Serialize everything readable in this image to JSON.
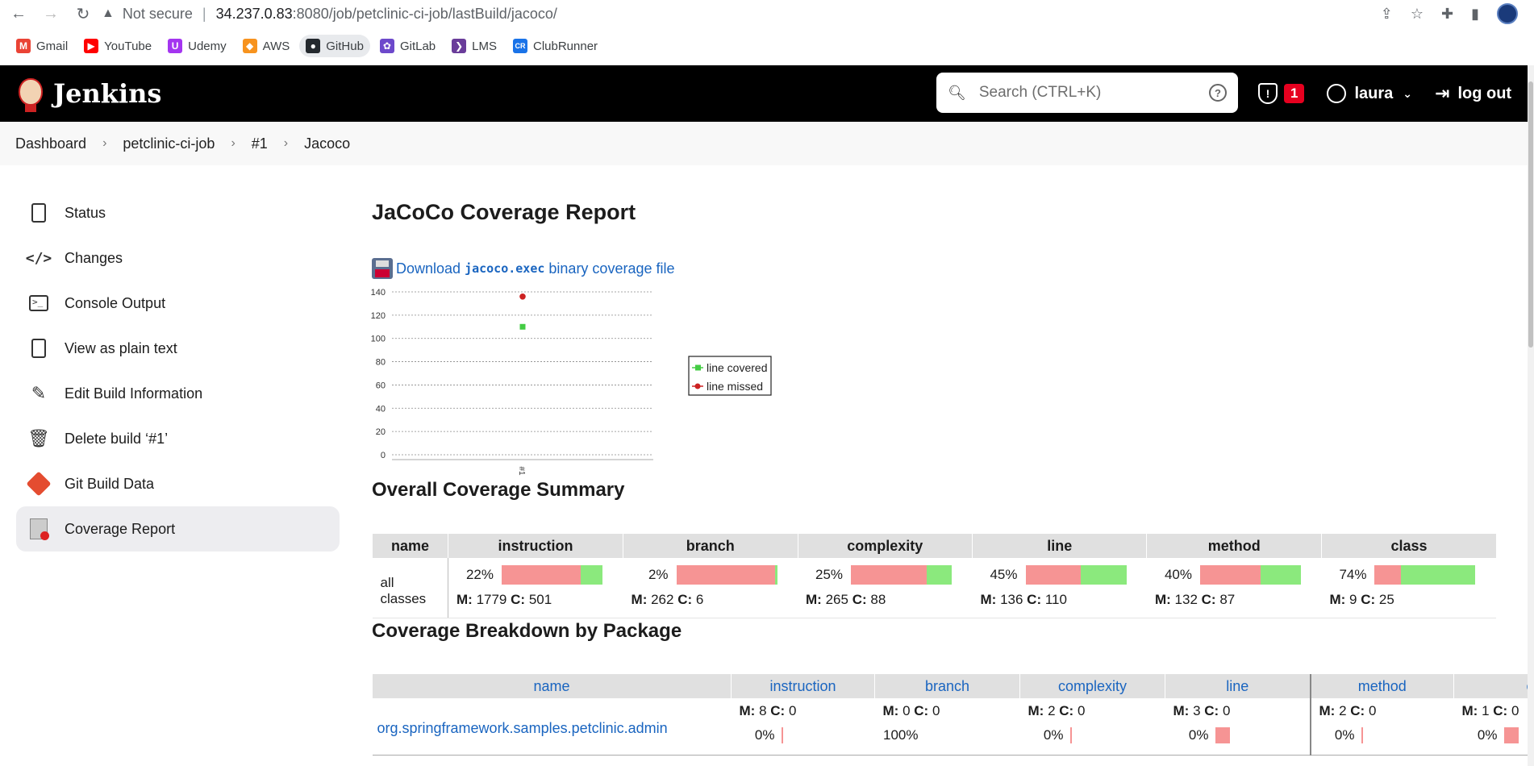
{
  "browser": {
    "security_label": "Not secure",
    "url_host": "34.237.0.83",
    "url_path": ":8080/job/petclinic-ci-job/lastBuild/jacoco/",
    "bookmarks": [
      {
        "label": "Gmail",
        "color": "#ea4335",
        "glyph": "M"
      },
      {
        "label": "YouTube",
        "color": "#ff0000",
        "glyph": "▶"
      },
      {
        "label": "Udemy",
        "color": "#a435f0",
        "glyph": "U"
      },
      {
        "label": "AWS",
        "color": "#f7931e",
        "glyph": "◆"
      },
      {
        "label": "GitHub",
        "color": "#24292e",
        "glyph": "●"
      },
      {
        "label": "GitLab",
        "color": "#6d49cb",
        "glyph": "✿"
      },
      {
        "label": "LMS",
        "color": "#6a3d9a",
        "glyph": "❯"
      },
      {
        "label": "ClubRunner",
        "color": "#1a73e8",
        "glyph": "CR"
      }
    ]
  },
  "header": {
    "app_name": "Jenkins",
    "search_placeholder": "Search (CTRL+K)",
    "security_count": "1",
    "username": "laura",
    "logout_label": "log out"
  },
  "breadcrumb": [
    "Dashboard",
    "petclinic-ci-job",
    "#1",
    "Jacoco"
  ],
  "sidebar": {
    "items": [
      {
        "label": "Status",
        "icon": "document-icon"
      },
      {
        "label": "Changes",
        "icon": "code-icon"
      },
      {
        "label": "Console Output",
        "icon": "terminal-icon"
      },
      {
        "label": "View as plain text",
        "icon": "text-document-icon"
      },
      {
        "label": "Edit Build Information",
        "icon": "edit-icon"
      },
      {
        "label": "Delete build ‘#1’",
        "icon": "trash-icon"
      },
      {
        "label": "Git Build Data",
        "icon": "git-icon"
      },
      {
        "label": "Coverage Report",
        "icon": "coverage-report-icon"
      }
    ]
  },
  "main": {
    "title": "JaCoCo Coverage Report",
    "download_prefix": "Download",
    "download_code": "jacoco.exec",
    "download_suffix": "binary coverage file",
    "overall_heading": "Overall Coverage Summary",
    "breakdown_heading": "Coverage Breakdown by Package"
  },
  "chart_data": {
    "type": "scatter",
    "categories": [
      "#1"
    ],
    "series": [
      {
        "name": "line covered",
        "values": [
          110
        ],
        "color": "#44cc44"
      },
      {
        "name": "line missed",
        "values": [
          136
        ],
        "color": "#cc2222"
      }
    ],
    "ylim": [
      0,
      140
    ],
    "yticks": [
      0,
      20,
      40,
      60,
      80,
      100,
      120,
      140
    ],
    "grid": true,
    "legend": "right"
  },
  "summary": {
    "headers": [
      "name",
      "instruction",
      "branch",
      "complexity",
      "line",
      "method",
      "class"
    ],
    "row_name": "all classes",
    "cells": [
      {
        "pct": "22%",
        "m": "1779",
        "c": "501",
        "covered": 0.22
      },
      {
        "pct": "2%",
        "m": "262",
        "c": "6",
        "covered": 0.02
      },
      {
        "pct": "25%",
        "m": "265",
        "c": "88",
        "covered": 0.25
      },
      {
        "pct": "45%",
        "m": "136",
        "c": "110",
        "covered": 0.45
      },
      {
        "pct": "40%",
        "m": "132",
        "c": "87",
        "covered": 0.4
      },
      {
        "pct": "74%",
        "m": "9",
        "c": "25",
        "covered": 0.74
      }
    ]
  },
  "packages": {
    "headers": [
      "name",
      "instruction",
      "branch",
      "complexity",
      "line",
      "method",
      "c"
    ],
    "rows": [
      {
        "name": "org.springframework.samples.petclinic.admin",
        "cells": [
          {
            "m": "8",
            "c": "0",
            "pct": "0%"
          },
          {
            "m": "0",
            "c": "0",
            "pct": "100%"
          },
          {
            "m": "2",
            "c": "0",
            "pct": "0%"
          },
          {
            "m": "3",
            "c": "0",
            "pct": "0%"
          },
          {
            "m": "2",
            "c": "0",
            "pct": "0%"
          },
          {
            "m": "1",
            "c": "0",
            "pct": "0%"
          }
        ]
      }
    ]
  },
  "labels": {
    "m": "M:",
    "c": "C:"
  }
}
